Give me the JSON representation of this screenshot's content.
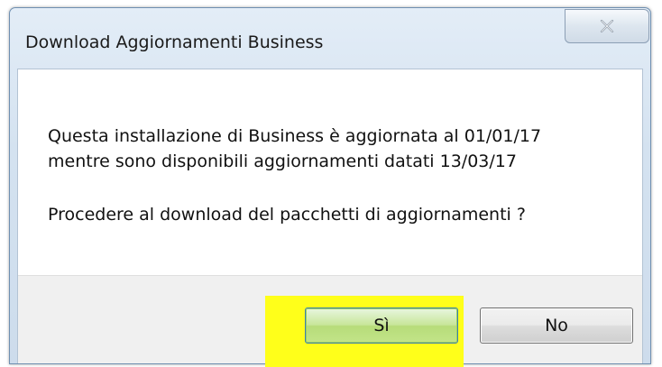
{
  "dialog": {
    "title": "Download Aggiornamenti Business",
    "close_icon": "close-x-icon",
    "message_line_1": "Questa installazione di Business è aggiornata al 01/01/17",
    "message_line_2": "mentre sono disponibili aggiornamenti datati 13/03/17",
    "question": "Procedere al download del pacchetti di aggiornamenti ?",
    "yes_label": "Sì",
    "no_label": "No",
    "highlight_color": "#ffff1a"
  }
}
